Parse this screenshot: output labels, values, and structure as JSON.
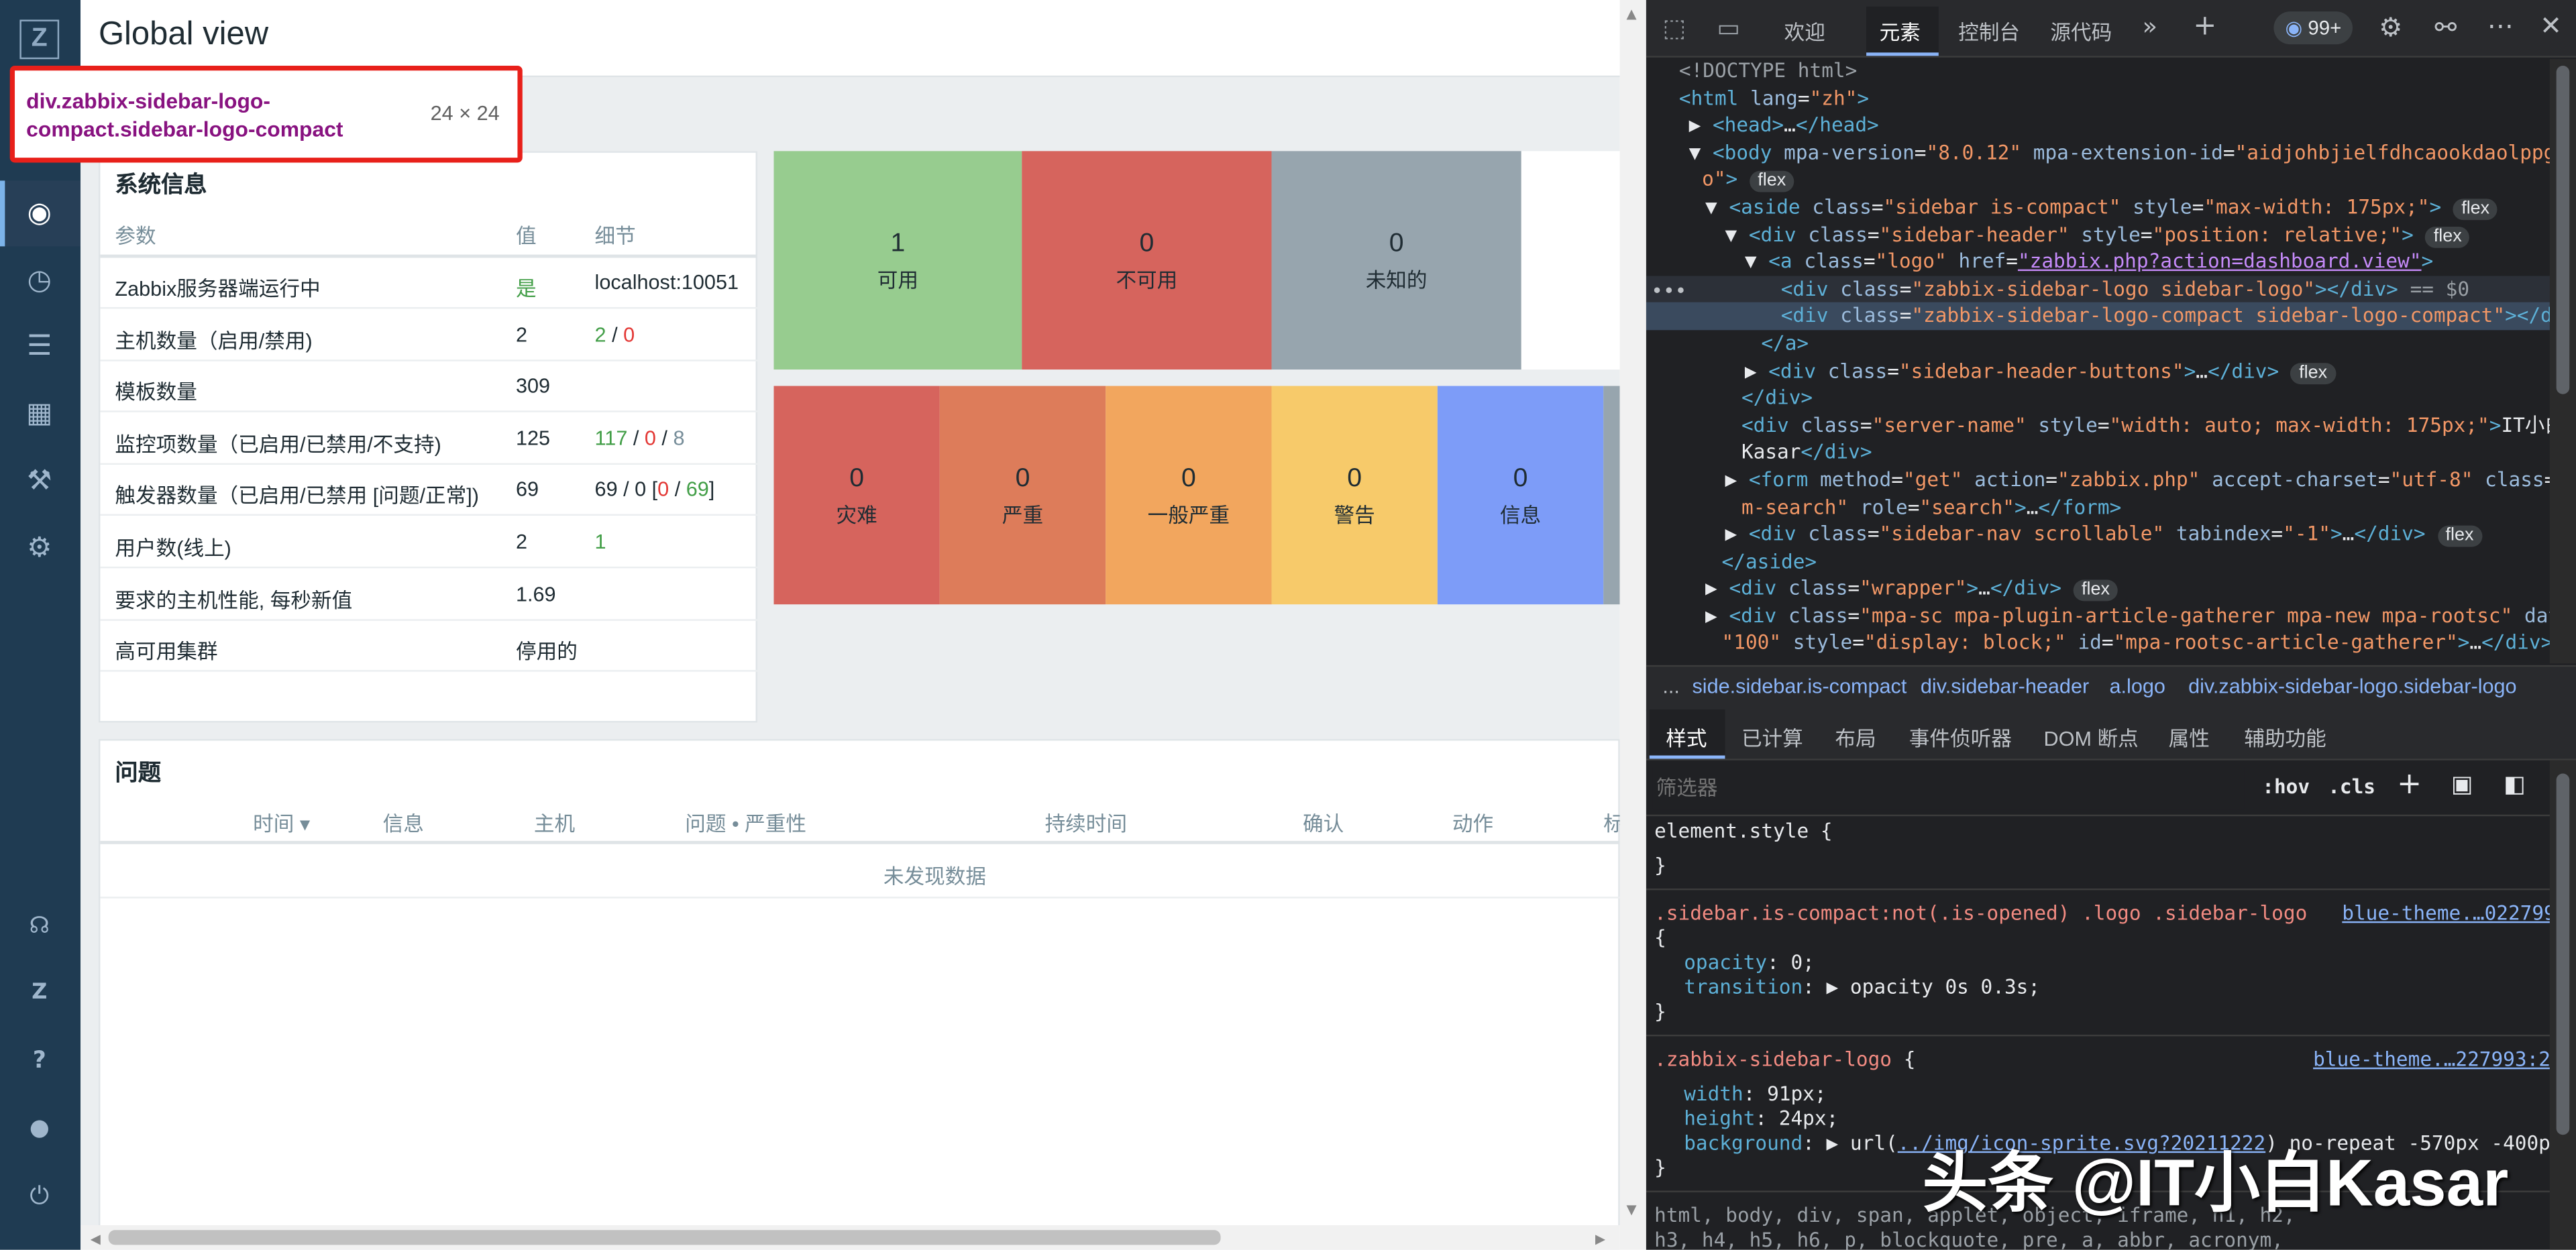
{
  "sidebar": {
    "logo_letter": "Z",
    "icons_top": [
      "eye-icon",
      "timer-icon",
      "list-icon",
      "chart-icon",
      "wrench-icon",
      "gear-icon"
    ],
    "icons_bottom": [
      "headset-icon",
      "zabbix-icon",
      "help-icon",
      "user-icon",
      "power-icon"
    ]
  },
  "tooltip": {
    "selector": "div.zabbix-sidebar-logo-compact.sidebar-logo-compact",
    "size": "24 × 24"
  },
  "page": {
    "title": "Global view"
  },
  "sysinfo": {
    "title": "系统信息",
    "headers": [
      "参数",
      "值",
      "细节"
    ],
    "rows": [
      {
        "param": "Zabbix服务器端运行中",
        "value": "是",
        "detail": "localhost:10051"
      },
      {
        "param": "主机数量（启用/禁用)",
        "value": "2",
        "detail_parts": [
          "2",
          " / ",
          "0"
        ]
      },
      {
        "param": "模板数量",
        "value": "309",
        "detail": ""
      },
      {
        "param": "监控项数量（已启用/已禁用/不支持)",
        "value": "125",
        "detail_parts": [
          "117",
          " / ",
          "0",
          " / ",
          "8"
        ]
      },
      {
        "param": "触发器数量（已启用/已禁用 [问题/正常])",
        "value": "69",
        "detail_parts": [
          "69 / 0 [",
          "0",
          " / ",
          "69",
          "]"
        ]
      },
      {
        "param": "用户数(线上)",
        "value": "2",
        "detail_parts": [
          "1"
        ]
      },
      {
        "param": "要求的主机性能, 每秒新值",
        "value": "1.69",
        "detail": ""
      },
      {
        "param": "高可用集群",
        "value": "停用的",
        "detail": ""
      }
    ]
  },
  "availability": [
    {
      "count": "1",
      "label": "可用",
      "color": "#97cc8f"
    },
    {
      "count": "0",
      "label": "不可用",
      "color": "#d6645d"
    },
    {
      "count": "0",
      "label": "未知的",
      "color": "#97a5ae"
    }
  ],
  "severity": [
    {
      "count": "0",
      "label": "灾难",
      "color": "#d6645d"
    },
    {
      "count": "0",
      "label": "严重",
      "color": "#dd7c5a"
    },
    {
      "count": "0",
      "label": "一般严重",
      "color": "#f2a65e"
    },
    {
      "count": "0",
      "label": "警告",
      "color": "#f7ca6a"
    },
    {
      "count": "0",
      "label": "信息",
      "color": "#7d9cf8"
    }
  ],
  "problems": {
    "title": "问题",
    "headers": [
      "时间 ▾",
      "信息",
      "主机",
      "问题 • 严重性",
      "持续时间",
      "确认",
      "动作",
      "标"
    ],
    "empty": "未发现数据"
  },
  "devtools": {
    "tabs": [
      "欢迎",
      "元素",
      "控制台",
      "源代码"
    ],
    "issues": "99+",
    "breadcrumb": [
      "...",
      "side.sidebar.is-compact",
      "div.sidebar-header",
      "a.logo",
      "div.zabbix-sidebar-logo.sidebar-logo"
    ],
    "style_tabs": [
      "样式",
      "已计算",
      "布局",
      "事件侦听器",
      "DOM 断点",
      "属性",
      "辅助功能"
    ],
    "filter_placeholder": "筛选器",
    "filter_buttons": [
      ":hov",
      ".cls"
    ]
  },
  "watermark": "头条 @IT小白Kasar"
}
